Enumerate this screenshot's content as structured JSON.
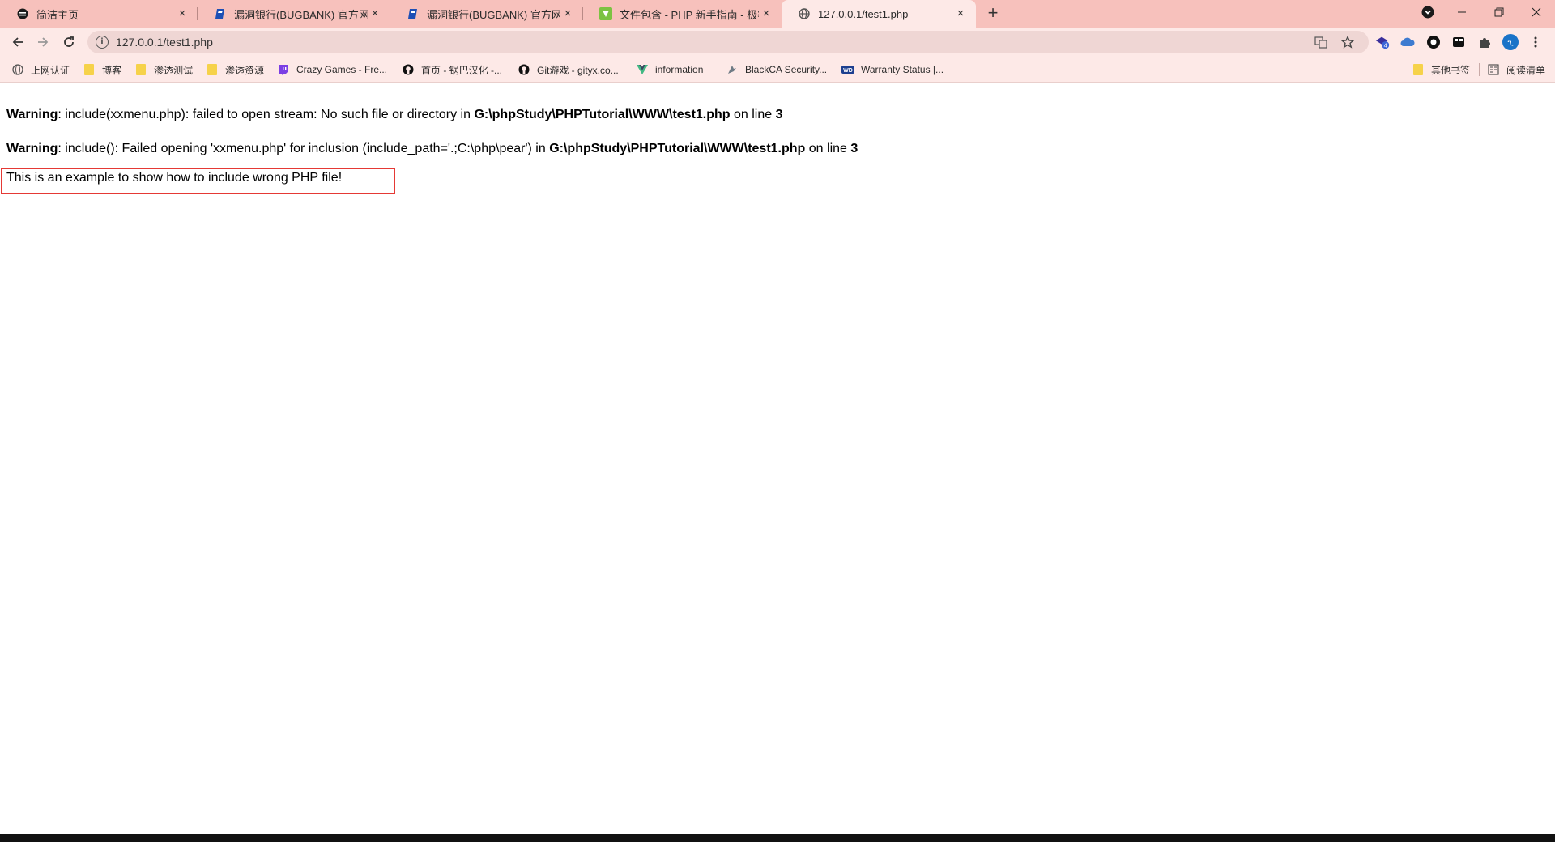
{
  "browser": {
    "tabs": [
      {
        "title": "简洁主页",
        "favicon": "shield-favicon",
        "active": false
      },
      {
        "title": "漏洞银行(BUGBANK) 官方网站 |",
        "favicon": "bugbank-favicon",
        "active": false
      },
      {
        "title": "漏洞银行(BUGBANK) 官方网站 |",
        "favicon": "bugbank-favicon",
        "active": false
      },
      {
        "title": "文件包含 - PHP 新手指南 - 极客",
        "favicon": "jikexueyuan-favicon",
        "active": false
      },
      {
        "title": "127.0.0.1/test1.php",
        "favicon": "globe-favicon",
        "active": true
      }
    ],
    "new_tab_label": "+",
    "close_glyph": "×",
    "address": {
      "url": "127.0.0.1/test1.php"
    },
    "profile_initial": "ጊ",
    "extension_badge": "4",
    "bookmarks": [
      {
        "label": "上网认证",
        "icon": "globe-icon"
      },
      {
        "label": "博客",
        "icon": "folder-icon"
      },
      {
        "label": "渗透测试",
        "icon": "folder-icon"
      },
      {
        "label": "渗透资源",
        "icon": "folder-icon"
      },
      {
        "label": "Crazy Games - Fre...",
        "icon": "twitch-icon"
      },
      {
        "label": "首页 - 锅巴汉化 -...",
        "icon": "github-icon"
      },
      {
        "label": "Git游戏 - gityx.co...",
        "icon": "github-icon"
      },
      {
        "label": "information",
        "icon": "vue-icon"
      },
      {
        "label": "BlackCA Security...",
        "icon": "bird-icon"
      },
      {
        "label": "Warranty Status |...",
        "icon": "wd-icon"
      }
    ],
    "other_bookmarks": "其他书签",
    "reading_list": "阅读清单"
  },
  "page": {
    "warnings": [
      {
        "label": "Warning",
        "message": ": include(xxmenu.php): failed to open stream: No such file or directory in ",
        "path": "G:\\phpStudy\\PHPTutorial\\WWW\\test1.php",
        "on_line": " on line ",
        "line": "3"
      },
      {
        "label": "Warning",
        "message": ": include(): Failed opening 'xxmenu.php' for inclusion (include_path='.;C:\\php\\pear') in ",
        "path": "G:\\phpStudy\\PHPTutorial\\WWW\\test1.php",
        "on_line": " on line ",
        "line": "3"
      }
    ],
    "example_text": "This is an example to show how to include wrong PHP file!"
  },
  "colors": {
    "tabstrip": "#f7c1bc",
    "toolbar": "#fde9e7",
    "highlight": "#e53935"
  }
}
